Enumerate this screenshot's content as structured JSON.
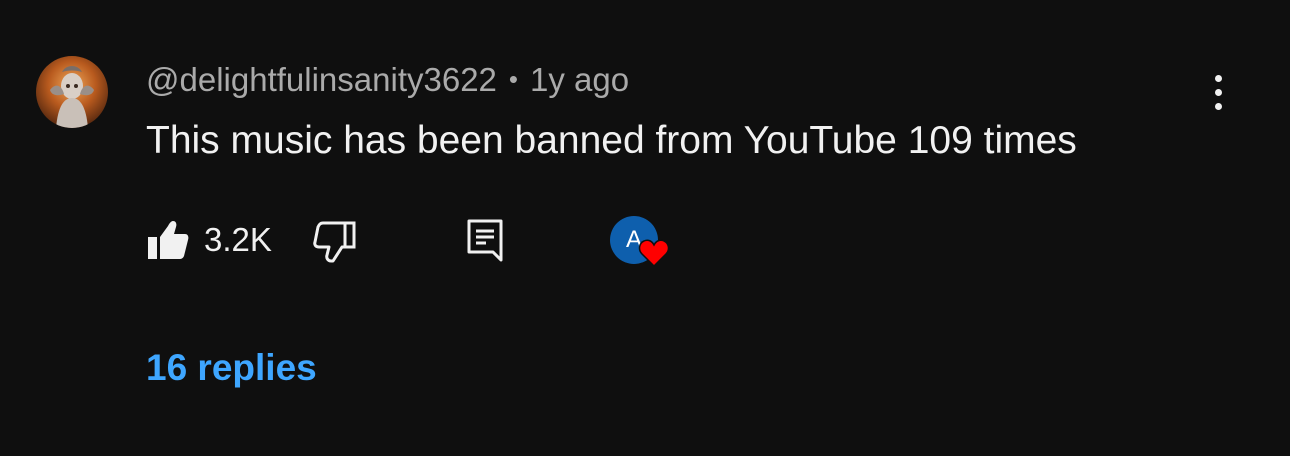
{
  "comment": {
    "author": "@delightfulinsanity3622",
    "separator": "•",
    "timestamp": "1y ago",
    "text": "This music has been banned from YouTube 109 times",
    "like_count": "3.2K",
    "hearted_by_initial": "A",
    "replies_label": "16 replies"
  },
  "icons": {
    "avatar": "avatar-image",
    "menu": "more-vertical-icon",
    "like": "thumbs-up-filled-icon",
    "dislike": "thumbs-down-outline-icon",
    "reply": "comment-reply-icon",
    "heart": "heart-icon"
  },
  "colors": {
    "background": "#0f0f0f",
    "primary_text": "#f1f1f1",
    "secondary_text": "#aaaaaa",
    "link": "#3ea6ff",
    "heart": "#ff0000",
    "creator_avatar": "#0e5fad"
  }
}
